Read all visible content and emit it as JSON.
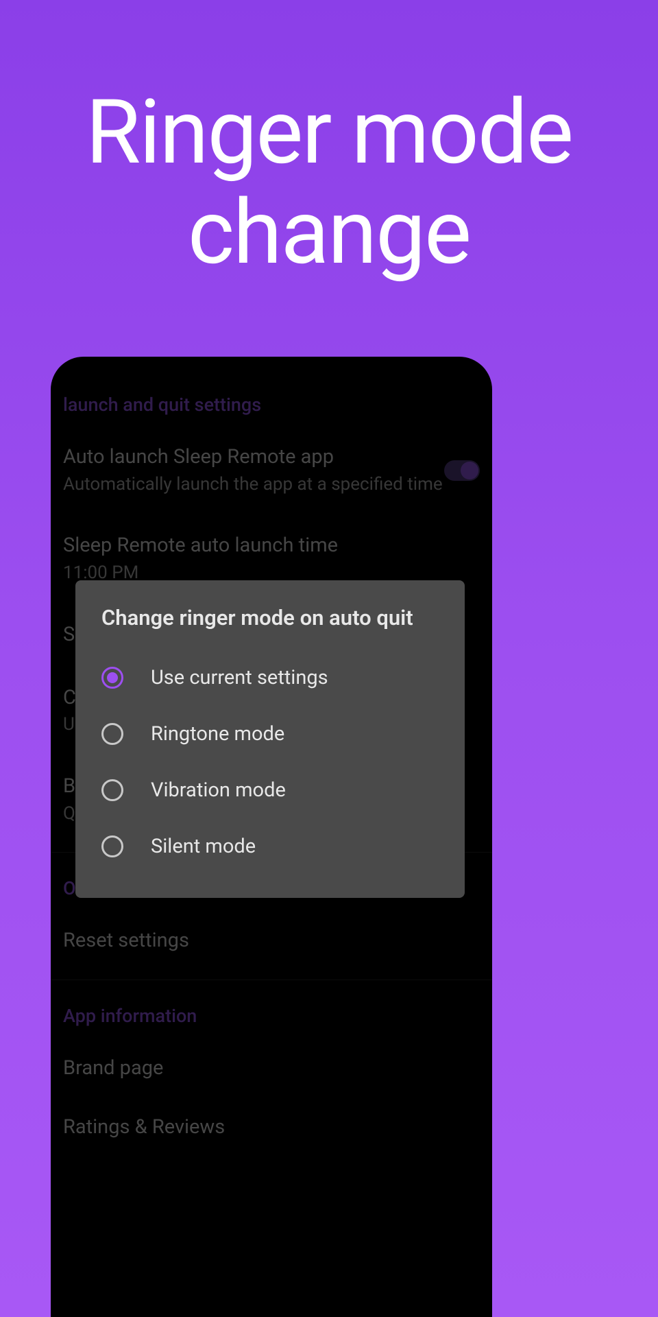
{
  "hero": {
    "title_line1": "Ringer mode",
    "title_line2": "change"
  },
  "settings": {
    "section1_header": "launch and quit settings",
    "auto_launch": {
      "title": "Auto launch Sleep Remote app",
      "subtitle": "Automatically launch the app at a specified time"
    },
    "launch_time": {
      "title": "Sleep Remote auto launch time",
      "subtitle": "11:00 PM"
    },
    "row_s": "S",
    "row_c": "C",
    "row_c_sub": "U",
    "row_b": "B",
    "row_b_sub": "Q",
    "section2_header": "O",
    "reset": "Reset settings",
    "section3_header": "App information",
    "brand": "Brand page",
    "ratings": "Ratings & Reviews"
  },
  "dialog": {
    "title": "Change ringer mode on auto quit",
    "options": [
      {
        "label": "Use current settings",
        "selected": true
      },
      {
        "label": "Ringtone mode",
        "selected": false
      },
      {
        "label": "Vibration mode",
        "selected": false
      },
      {
        "label": "Silent mode",
        "selected": false
      }
    ]
  }
}
